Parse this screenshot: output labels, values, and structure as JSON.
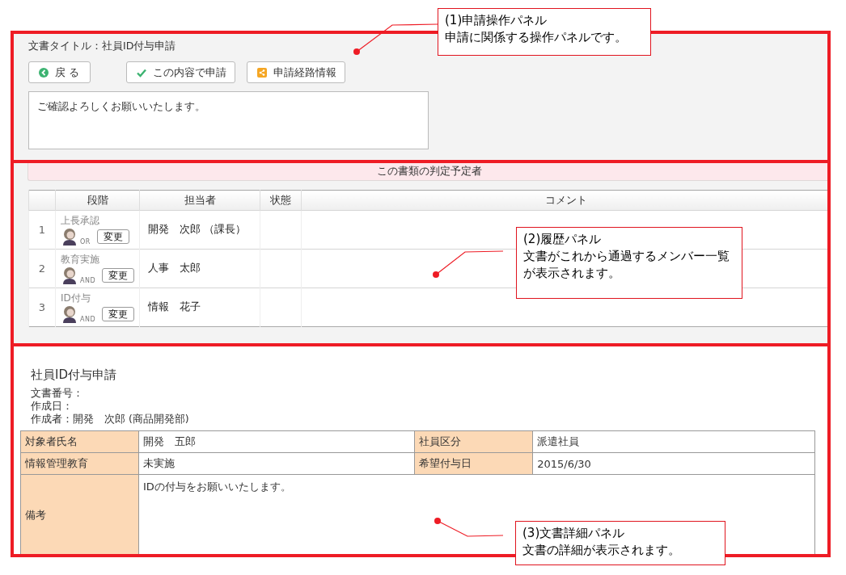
{
  "operation_panel": {
    "document_title": "文書タイトル：社員ID付与申請",
    "buttons": [
      {
        "kind": "back",
        "label": "戻 る"
      },
      {
        "kind": "submit",
        "label": "この内容で申請"
      },
      {
        "kind": "route",
        "label": "申請経路情報"
      }
    ],
    "comment_field": {
      "value": "ご確認よろしくお願いいたします。"
    }
  },
  "history_panel": {
    "header": "この書類の判定予定者",
    "columns": [
      "段階",
      "担当者",
      "状態",
      "コメント"
    ],
    "rows": [
      {
        "no": "1",
        "stage": "上長承認",
        "mode": "OR",
        "change_button": "変更",
        "assignee": "開発　次郎 （課長）"
      },
      {
        "no": "2",
        "stage": "教育実施",
        "mode": "AND",
        "change_button": "変更",
        "assignee": "人事　太郎"
      },
      {
        "no": "3",
        "stage": "ID付与",
        "mode": "AND",
        "change_button": "変更",
        "assignee": "情報　花子"
      }
    ]
  },
  "detail_panel": {
    "title": "社員ID付与申請",
    "meta": [
      "文書番号：",
      "作成日：",
      "作成者：開発　次郎 (商品開発部)"
    ],
    "rows": [
      {
        "cells": [
          {
            "kind": "label",
            "text": "対象者氏名"
          },
          {
            "kind": "value",
            "text": "開発　五郎"
          },
          {
            "kind": "label",
            "text": "社員区分"
          },
          {
            "kind": "value",
            "text": "派遣社員"
          }
        ]
      },
      {
        "cells": [
          {
            "kind": "label",
            "text": "情報管理教育"
          },
          {
            "kind": "value",
            "text": "未実施"
          },
          {
            "kind": "label",
            "text": "希望付与日"
          },
          {
            "kind": "value",
            "text": "2015/6/30"
          }
        ]
      },
      {
        "cells": [
          {
            "kind": "label",
            "text": "備考"
          },
          {
            "kind": "wide",
            "colspan": 3,
            "text": "IDの付与をお願いいたします。"
          }
        ]
      }
    ]
  },
  "callouts": [
    {
      "title": "(1)申請操作パネル",
      "text": "申請に関係する操作パネルです。"
    },
    {
      "title": "(2)履歴パネル",
      "text": "文書がこれから通過するメンバー一覧が表示されます。"
    },
    {
      "title": "(3)文書詳細パネル",
      "text": "文書の詳細が表示されます。"
    }
  ]
}
